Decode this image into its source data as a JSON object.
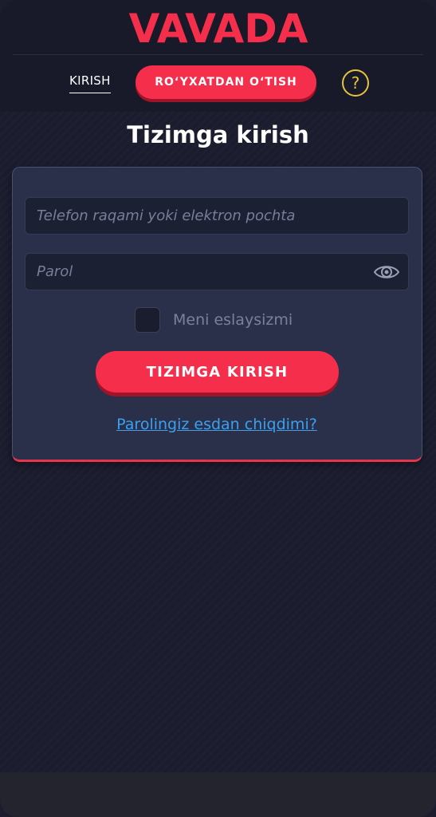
{
  "brand": {
    "logo_text": "VAVADA",
    "accent_color": "#f52f4b",
    "help_color": "#e7c33c",
    "link_color": "#3aa0f0"
  },
  "header": {
    "login_tab": "KIRISH",
    "register_button": "RO‘YXATDAN O‘TISH",
    "help_icon": "question-circle-icon",
    "help_glyph": "?"
  },
  "page": {
    "title": "Tizimga kirish"
  },
  "form": {
    "login_placeholder": "Telefon raqami yoki elektron pochta",
    "login_value": "",
    "password_placeholder": "Parol",
    "password_value": "",
    "show_password_icon": "eye-icon",
    "remember_label": "Meni eslaysizmi",
    "remember_checked": false,
    "submit_label": "TIZIMGA KIRISH",
    "forgot_link": "Parolingiz esdan chiqdimi?"
  }
}
